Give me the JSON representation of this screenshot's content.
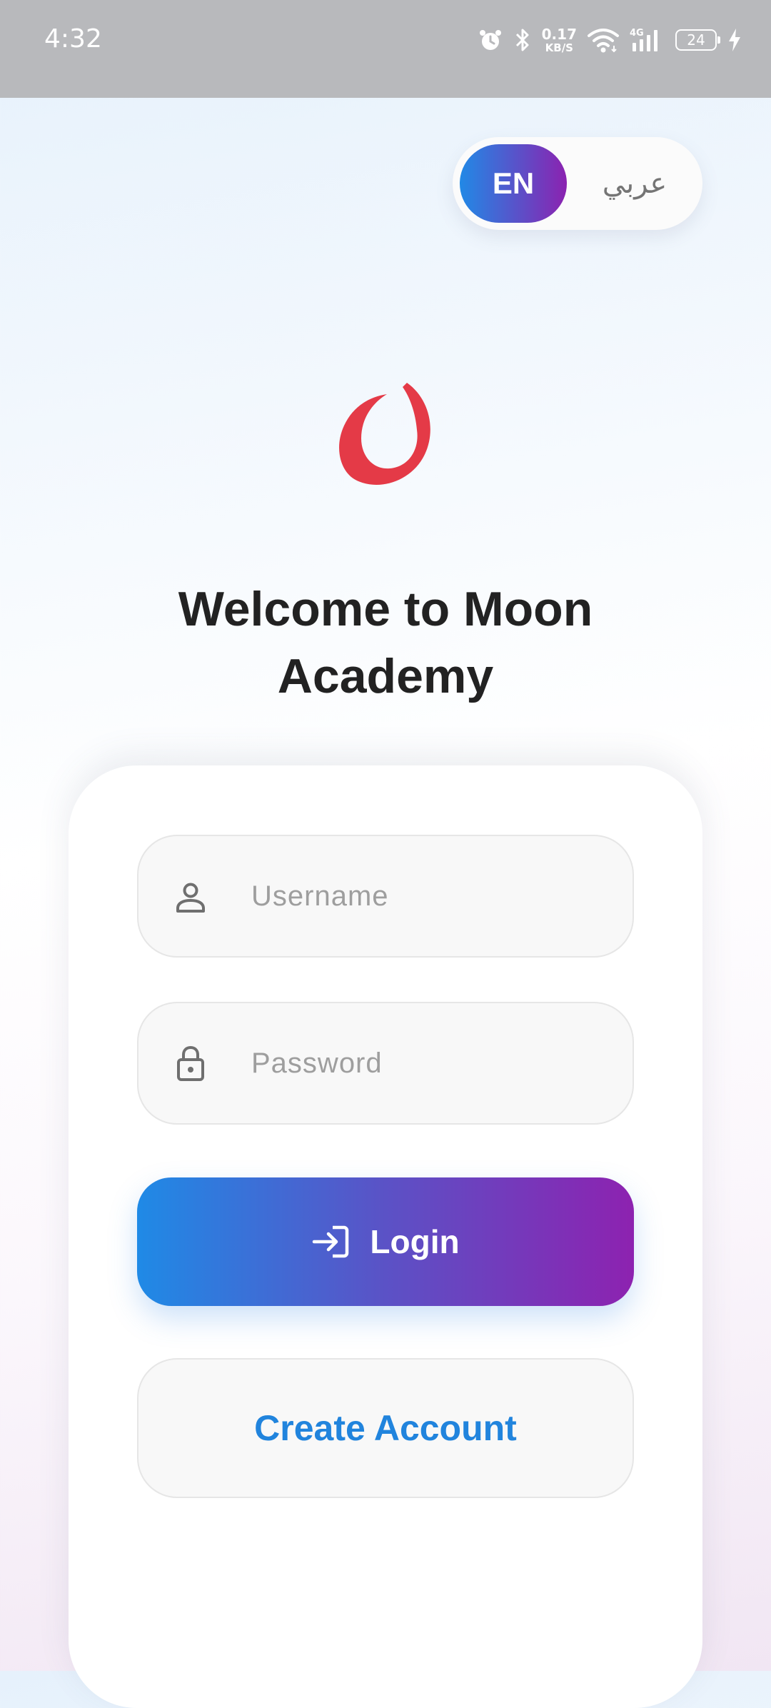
{
  "status_bar": {
    "time": "4:32",
    "net_speed_value": "0.17",
    "net_speed_unit": "KB/S",
    "network_type": "4G",
    "battery_level": "24"
  },
  "language_toggle": {
    "english_label": "EN",
    "arabic_label": "عربي",
    "selected": "EN"
  },
  "header": {
    "title": "Welcome to Moon Academy"
  },
  "login_form": {
    "username_placeholder": "Username",
    "username_value": "",
    "password_placeholder": "Password",
    "password_value": "",
    "login_label": "Login",
    "create_account_label": "Create Account"
  },
  "icons": {
    "logo": "moon-crescent-icon",
    "username": "user-icon",
    "password": "lock-icon",
    "login": "login-arrow-icon"
  },
  "colors": {
    "gradient_start": "#2189e6",
    "gradient_end": "#8b22b0",
    "logo": "#e43a47",
    "link": "#2184dd",
    "title": "#222222"
  }
}
